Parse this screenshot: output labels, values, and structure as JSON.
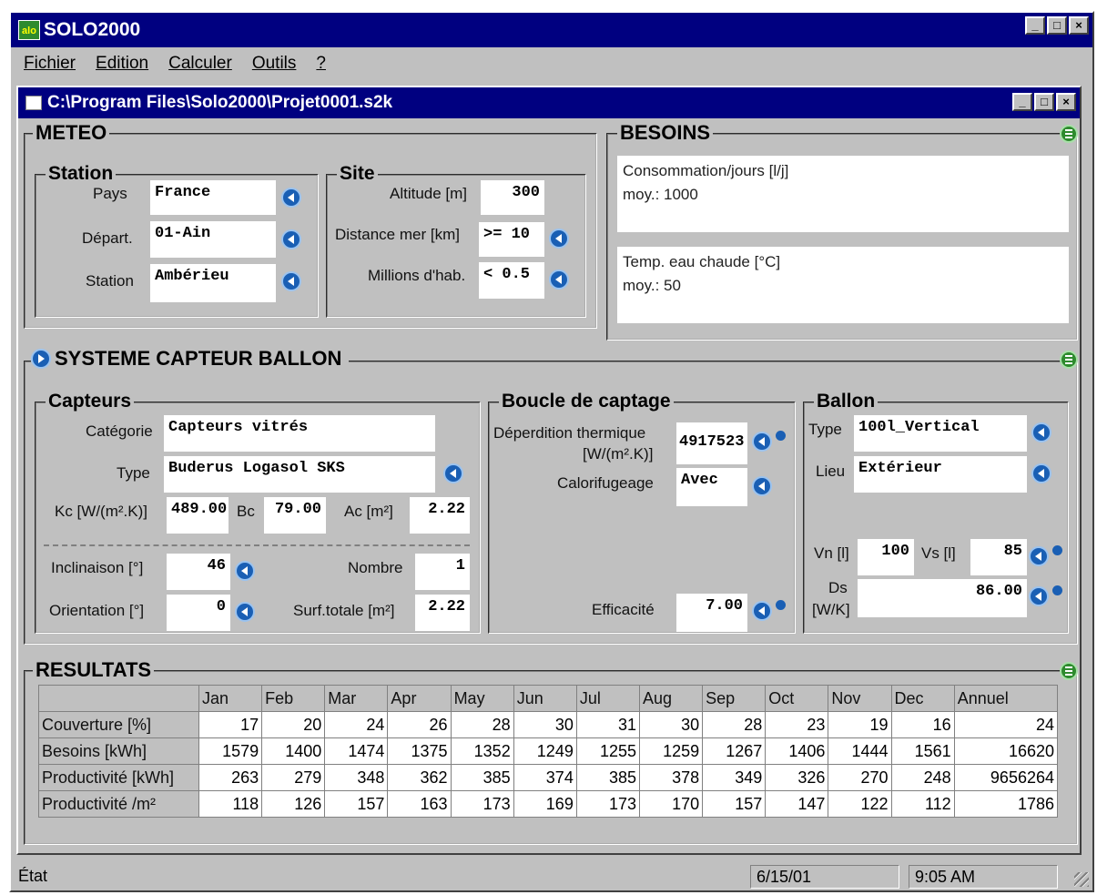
{
  "app": {
    "title": "SOLO2000",
    "logo_text": "alo"
  },
  "menu": [
    "Fichier",
    "Edition",
    "Calculer",
    "Outils",
    "?"
  ],
  "document": {
    "path": "C:\\Program Files\\Solo2000\\Projet0001.s2k"
  },
  "meteo": {
    "title": "METEO",
    "station_group": "Station",
    "pays_label": "Pays",
    "pays": "France",
    "depart_label": "Départ.",
    "depart": "01-Ain",
    "station_label": "Station",
    "station": "Ambérieu",
    "site_group": "Site",
    "altitude_label": "Altitude [m]",
    "altitude": "300",
    "distance_label": "Distance mer [km]",
    "distance": ">= 10",
    "habitants_label": "Millions d'hab.",
    "habitants": "< 0.5"
  },
  "besoins": {
    "title": "BESOINS",
    "conso_label": "Consommation/jours [l/j]",
    "conso_value": "moy.: 1000",
    "temp_label": "Temp. eau chaude [°C]",
    "temp_value": "moy.: 50"
  },
  "systeme": {
    "title": "SYSTEME CAPTEUR BALLON",
    "capteurs": {
      "title": "Capteurs",
      "categorie_label": "Catégorie",
      "categorie": "Capteurs vitrés",
      "type_label": "Type",
      "type": "Buderus Logasol SKS",
      "kc_label": "Kc [W/(m².K)]",
      "kc": "489.00",
      "bc_label": "Bc",
      "bc": "79.00",
      "ac_label": "Ac [m²]",
      "ac": "2.22",
      "inclinaison_label": "Inclinaison [°]",
      "inclinaison": "46",
      "nombre_label": "Nombre",
      "nombre": "1",
      "orientation_label": "Orientation [°]",
      "orientation": "0",
      "surf_label": "Surf.totale [m²]",
      "surf": "2.22"
    },
    "boucle": {
      "title": "Boucle de captage",
      "deperdition_label1": "Déperdition thermique",
      "deperdition_label2": "[W/(m².K)]",
      "deperdition": "4917523",
      "calorifugeage_label": "Calorifugeage",
      "calorifugeage": "Avec",
      "efficacite_label": "Efficacité",
      "efficacite": "7.00"
    },
    "ballon": {
      "title": "Ballon",
      "type_label": "Type",
      "type": "100l_Vertical",
      "lieu_label": "Lieu",
      "lieu": "Extérieur",
      "vn_label": "Vn [l]",
      "vn": "100",
      "vs_label": "Vs [l]",
      "vs": "85",
      "ds_label1": "Ds",
      "ds_label2": "[W/K]",
      "ds": "86.00"
    }
  },
  "resultats": {
    "title": "RESULTATS",
    "columns": [
      "Jan",
      "Feb",
      "Mar",
      "Apr",
      "May",
      "Jun",
      "Jul",
      "Aug",
      "Sep",
      "Oct",
      "Nov",
      "Dec",
      "Annuel"
    ],
    "rows": [
      {
        "label": "Couverture [%]",
        "values": [
          "17",
          "20",
          "24",
          "26",
          "28",
          "30",
          "31",
          "30",
          "28",
          "23",
          "19",
          "16",
          "24"
        ]
      },
      {
        "label": "Besoins [kWh]",
        "values": [
          "1579",
          "1400",
          "1474",
          "1375",
          "1352",
          "1249",
          "1255",
          "1259",
          "1267",
          "1406",
          "1444",
          "1561",
          "16620"
        ]
      },
      {
        "label": "Productivité [kWh]",
        "values": [
          "263",
          "279",
          "348",
          "362",
          "385",
          "374",
          "385",
          "378",
          "349",
          "326",
          "270",
          "248",
          "9656264"
        ]
      },
      {
        "label": "Productivité /m²",
        "values": [
          "118",
          "126",
          "157",
          "163",
          "173",
          "169",
          "173",
          "170",
          "157",
          "147",
          "122",
          "112",
          "1786"
        ]
      }
    ]
  },
  "status": {
    "state": "État",
    "date": "6/15/01",
    "time": "9:05 AM"
  },
  "colors": {
    "titlebar": "#000080",
    "face": "#c0c0c0",
    "info_button": "#1a5fb4",
    "expand_button": "#2e8b2e"
  }
}
